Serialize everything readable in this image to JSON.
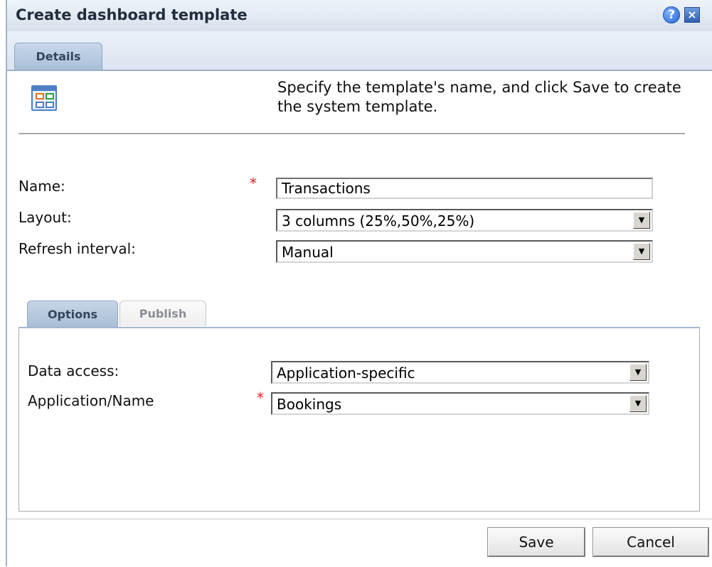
{
  "window": {
    "title": "Create dashboard template",
    "help_glyph": "?",
    "close_glyph": "×"
  },
  "top_tabs": [
    {
      "label": "Details"
    }
  ],
  "instructions": "Specify the template's name, and click Save to create the system template.",
  "fields": {
    "name": {
      "label": "Name:",
      "required_mark": "*",
      "value": "Transactions"
    },
    "layout": {
      "label": "Layout:",
      "value": "3 columns (25%,50%,25%)"
    },
    "refresh": {
      "label": "Refresh interval:",
      "value": "Manual"
    }
  },
  "inner_tabs": {
    "options": "Options",
    "publish": "Publish"
  },
  "options_panel": {
    "data_access": {
      "label": "Data access:",
      "value": "Application-specific"
    },
    "application": {
      "label": "Application/Name",
      "required_mark": "*",
      "value": "Bookings"
    }
  },
  "buttons": {
    "save": "Save",
    "cancel": "Cancel"
  },
  "icons": {
    "dashboard": "dashboard-icon",
    "help": "help-icon",
    "close": "close-icon",
    "dropdown": "chevron-down-icon"
  },
  "colors": {
    "required": "#e02020",
    "tab_active": "#a9bfd9",
    "titlebar": "#d7e1ec"
  }
}
